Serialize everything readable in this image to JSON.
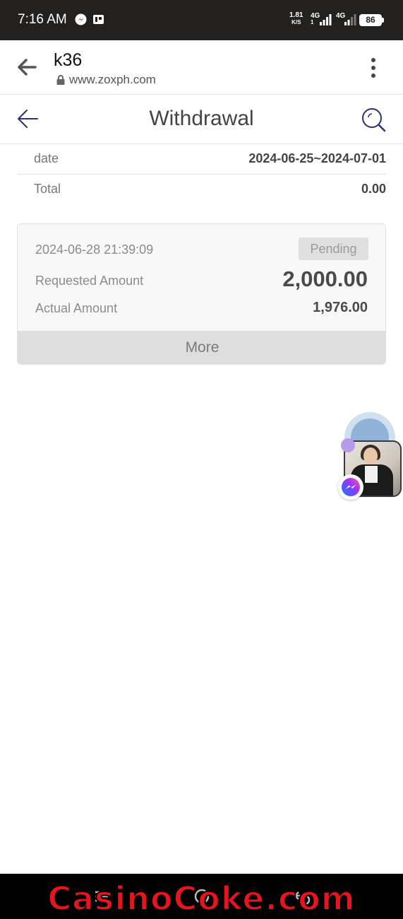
{
  "status_bar": {
    "time": "7:16 AM",
    "net_speed_value": "1.81",
    "net_speed_unit": "K/S",
    "signal1_label": "4G",
    "signal1_sub": "1",
    "signal2_label": "4G",
    "battery": "86",
    "icons": [
      "messenger-icon",
      "powerpoint-icon",
      "signal-icon",
      "battery-icon"
    ]
  },
  "browser": {
    "title": "k36",
    "url": "www.zoxph.com"
  },
  "header": {
    "title": "Withdrawal"
  },
  "summary": {
    "date_label": "date",
    "date_value": "2024-06-25~2024-07-01",
    "total_label": "Total",
    "total_value": "0.00"
  },
  "records": [
    {
      "datetime": "2024-06-28 21:39:09",
      "status": "Pending",
      "requested_label": "Requested Amount",
      "requested_amount": "2,000.00",
      "actual_label": "Actual Amount",
      "actual_amount": "1,976.00",
      "more_label": "More"
    }
  ],
  "watermark": "CasinoCoke.com",
  "colors": {
    "accent": "#2c2f7a",
    "pending_bg": "#e0e0e0",
    "watermark": "#e8141c"
  }
}
